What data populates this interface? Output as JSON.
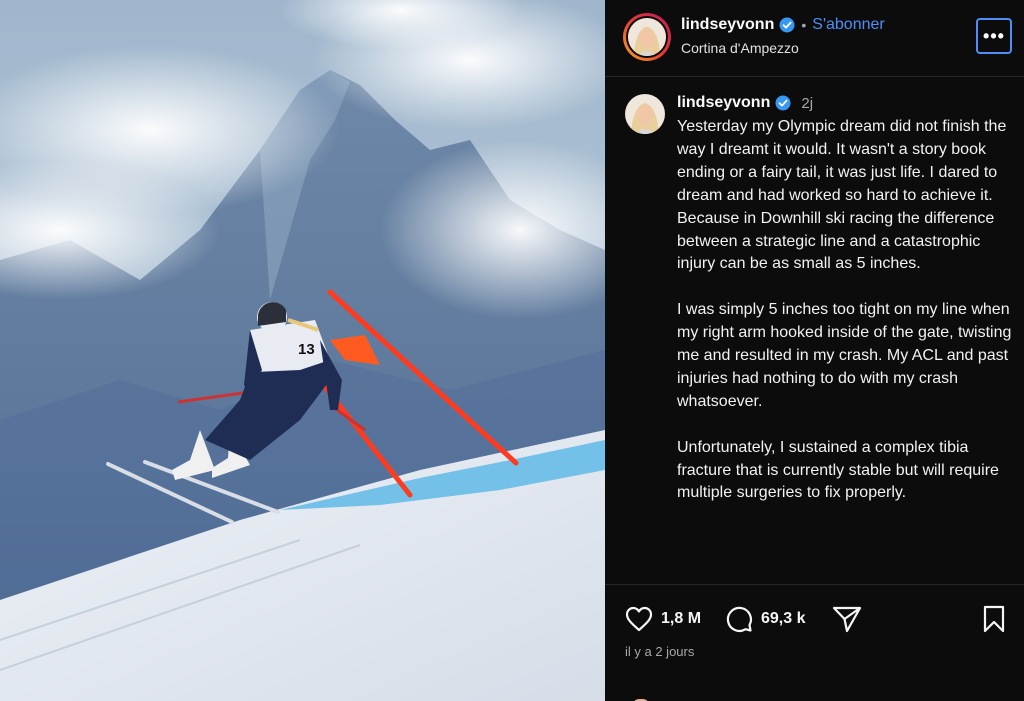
{
  "post": {
    "username": "lindseyvonn",
    "separator": "•",
    "follow_label": "S'abonner",
    "location": "Cortina d'Ampezzo",
    "more_label": "•••",
    "time_ago": "2j",
    "bib_number": "13",
    "caption_paragraphs": [
      "Yesterday my Olympic dream did not finish the way I dreamt it would. It wasn't a story book ending or a fairy tail, it was just life. I dared to dream and had worked so hard to achieve it. Because in Downhill ski racing the difference between a strategic line and a catastrophic injury can be as small as 5 inches.",
      "I was simply 5 inches too tight on my line when my right arm hooked inside of the gate, twisting me and resulted in my crash. My ACL and past injuries had nothing to do with my crash whatsoever.",
      "Unfortunately, I sustained a complex tibia fracture that is currently stable but will require multiple surgeries to fix properly."
    ],
    "likes": "1,8 M",
    "comments": "69,3 k",
    "timestamp": "il y a 2 jours"
  },
  "icons": {
    "verified": "verified-badge-icon",
    "like": "heart-icon",
    "comment": "comment-bubble-icon",
    "share": "paper-plane-icon",
    "save": "bookmark-icon",
    "more": "more-options-icon"
  },
  "colors": {
    "background": "#000000",
    "panel": "#0c0c0c",
    "link_blue": "#4f8ef7",
    "verified_blue": "#3897f0",
    "gate_red": "#ff3b1f",
    "muted_text": "#a8a8a8"
  }
}
